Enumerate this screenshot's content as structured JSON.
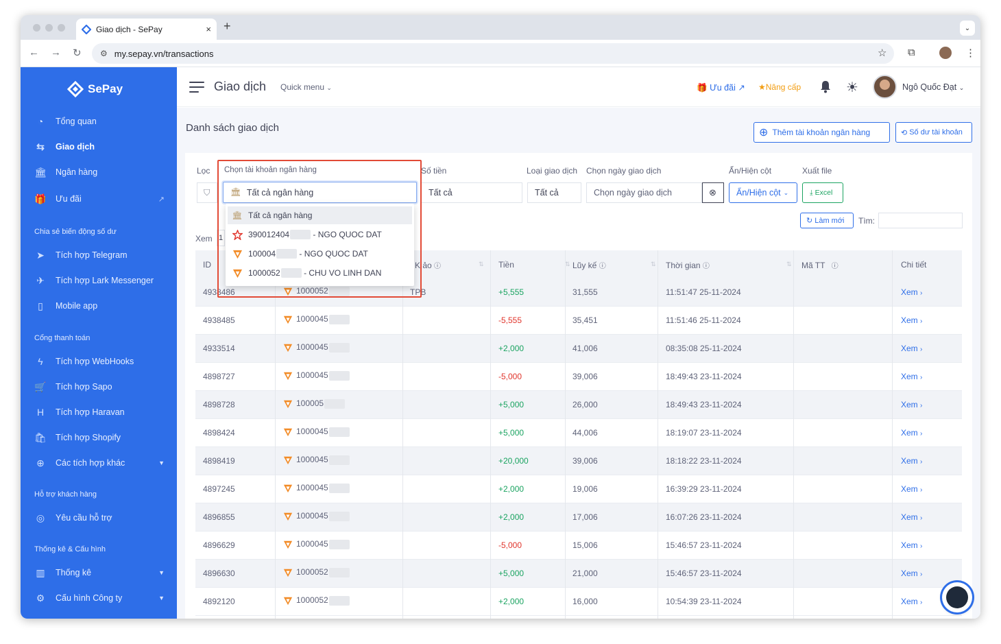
{
  "browser": {
    "tab_title": "Giao dịch - SePay",
    "tab_close": "×",
    "new_tab": "+",
    "url": "my.sepay.vn/transactions"
  },
  "sidebar": {
    "brand": "SePay",
    "items": [
      {
        "label": "Tổng quan",
        "icon": "dashboard-icon"
      },
      {
        "label": "Giao dịch",
        "icon": "transfer-icon"
      },
      {
        "label": "Ngân hàng",
        "icon": "bank-icon"
      },
      {
        "label": "Ưu đãi",
        "icon": "gift-icon"
      }
    ],
    "section1": "Chia sẻ biến động số dư",
    "share_items": [
      {
        "label": "Tích hợp Telegram",
        "icon": "telegram-icon"
      },
      {
        "label": "Tích hợp Lark Messenger",
        "icon": "send-icon"
      },
      {
        "label": "Mobile app",
        "icon": "mobile-icon"
      }
    ],
    "section2": "Cổng thanh toán",
    "pay_items": [
      {
        "label": "Tích hợp WebHooks",
        "icon": "bolt-icon"
      },
      {
        "label": "Tích hợp Sapo",
        "icon": "cart-icon"
      },
      {
        "label": "Tích hợp Haravan",
        "icon": "haravan-icon"
      },
      {
        "label": "Tích hợp Shopify",
        "icon": "shopify-icon"
      },
      {
        "label": "Các tích hợp khác",
        "icon": "plugin-icon"
      }
    ],
    "section3": "Hỗ trợ khách hàng",
    "support_items": [
      {
        "label": "Yêu cầu hỗ trợ",
        "icon": "lifebuoy-icon"
      }
    ],
    "section4": "Thống kê & Cấu hình",
    "config_items": [
      {
        "label": "Thống kê",
        "icon": "chart-icon"
      },
      {
        "label": "Cấu hình Công ty",
        "icon": "settings-icon"
      }
    ]
  },
  "header": {
    "title": "Giao dịch",
    "quick_menu": "Quick menu",
    "uu_dai": "Ưu đãi",
    "nang_cap": "Nâng cấp",
    "user_name": "Ngô Quốc Đạt"
  },
  "page": {
    "list_title": "Danh sách giao dịch",
    "add_bank_button": "Thêm tài khoản ngân hàng",
    "balance_button": "Số dư tài khoản"
  },
  "filters": {
    "loc_label": "Lọc",
    "bank_label": "Chọn tài khoản ngân hàng",
    "bank_value": "Tất cả ngân hàng",
    "amount_label": "Số tiền",
    "amount_value": "Tất cả",
    "type_label": "Loại giao dịch",
    "type_value": "Tất cả",
    "date_label": "Chọn ngày giao dịch",
    "date_placeholder": "Chọn ngày giao dịch",
    "columns_label": "Ẩn/Hiện cột",
    "columns_button": "Ẩn/Hiện cột",
    "export_label": "Xuất file",
    "export_button": "Excel",
    "refresh_button": "Làm mới",
    "search_label": "Tìm:",
    "show_label": "Xem"
  },
  "dropdown": {
    "options": [
      {
        "label": "Tất cả ngân hàng",
        "icon": "bank-icon"
      },
      {
        "prefix": "390012404",
        "suffix": "- NGO QUOC DAT",
        "icon": "star-bank-icon"
      },
      {
        "prefix": "100004",
        "suffix": "- NGO QUOC DAT",
        "icon": "tpbank-icon"
      },
      {
        "prefix": "1000052",
        "suffix": "- CHU VO LINH DAN",
        "icon": "tpbank-icon"
      }
    ]
  },
  "table": {
    "columns": [
      "ID",
      "Kho",
      "Tiền",
      "Lũy kế",
      "Thời gian",
      "Mã TT",
      "Chi tiết"
    ],
    "kho_partial": "K ảo",
    "rows": [
      {
        "id": "4938486",
        "account": "1000052",
        "tag": "TPB",
        "amount": "+5,555",
        "sign": "pos",
        "cumulative": "31,555",
        "time": "11:51:47 25-11-2024",
        "detail": "Xem"
      },
      {
        "id": "4938485",
        "account": "1000045",
        "tag": "",
        "amount": "-5,555",
        "sign": "neg",
        "cumulative": "35,451",
        "time": "11:51:46 25-11-2024",
        "detail": "Xem"
      },
      {
        "id": "4933514",
        "account": "1000045",
        "tag": "",
        "amount": "+2,000",
        "sign": "pos",
        "cumulative": "41,006",
        "time": "08:35:08 25-11-2024",
        "detail": "Xem"
      },
      {
        "id": "4898727",
        "account": "1000045",
        "tag": "",
        "amount": "-5,000",
        "sign": "neg",
        "cumulative": "39,006",
        "time": "18:49:43 23-11-2024",
        "detail": "Xem"
      },
      {
        "id": "4898728",
        "account": "100005",
        "tag": "",
        "amount": "+5,000",
        "sign": "pos",
        "cumulative": "26,000",
        "time": "18:49:43 23-11-2024",
        "detail": "Xem"
      },
      {
        "id": "4898424",
        "account": "1000045",
        "tag": "",
        "amount": "+5,000",
        "sign": "pos",
        "cumulative": "44,006",
        "time": "18:19:07 23-11-2024",
        "detail": "Xem"
      },
      {
        "id": "4898419",
        "account": "1000045",
        "tag": "",
        "amount": "+20,000",
        "sign": "pos",
        "cumulative": "39,006",
        "time": "18:18:22 23-11-2024",
        "detail": "Xem"
      },
      {
        "id": "4897245",
        "account": "1000045",
        "tag": "",
        "amount": "+2,000",
        "sign": "pos",
        "cumulative": "19,006",
        "time": "16:39:29 23-11-2024",
        "detail": "Xem"
      },
      {
        "id": "4896855",
        "account": "1000045",
        "tag": "",
        "amount": "+2,000",
        "sign": "pos",
        "cumulative": "17,006",
        "time": "16:07:26 23-11-2024",
        "detail": "Xem"
      },
      {
        "id": "4896629",
        "account": "1000045",
        "tag": "",
        "amount": "-5,000",
        "sign": "neg",
        "cumulative": "15,006",
        "time": "15:46:57 23-11-2024",
        "detail": "Xem"
      },
      {
        "id": "4896630",
        "account": "1000052",
        "tag": "",
        "amount": "+5,000",
        "sign": "pos",
        "cumulative": "21,000",
        "time": "15:46:57 23-11-2024",
        "detail": "Xem"
      },
      {
        "id": "4892120",
        "account": "1000052",
        "tag": "",
        "amount": "+2,000",
        "sign": "pos",
        "cumulative": "16,000",
        "time": "10:54:39 23-11-2024",
        "detail": "Xem"
      }
    ]
  },
  "colors": {
    "primary": "#2e6ee8",
    "positive": "#1aa360",
    "negative": "#e0342b",
    "upgrade": "#f29d12",
    "highlight_frame": "#e24a36"
  }
}
